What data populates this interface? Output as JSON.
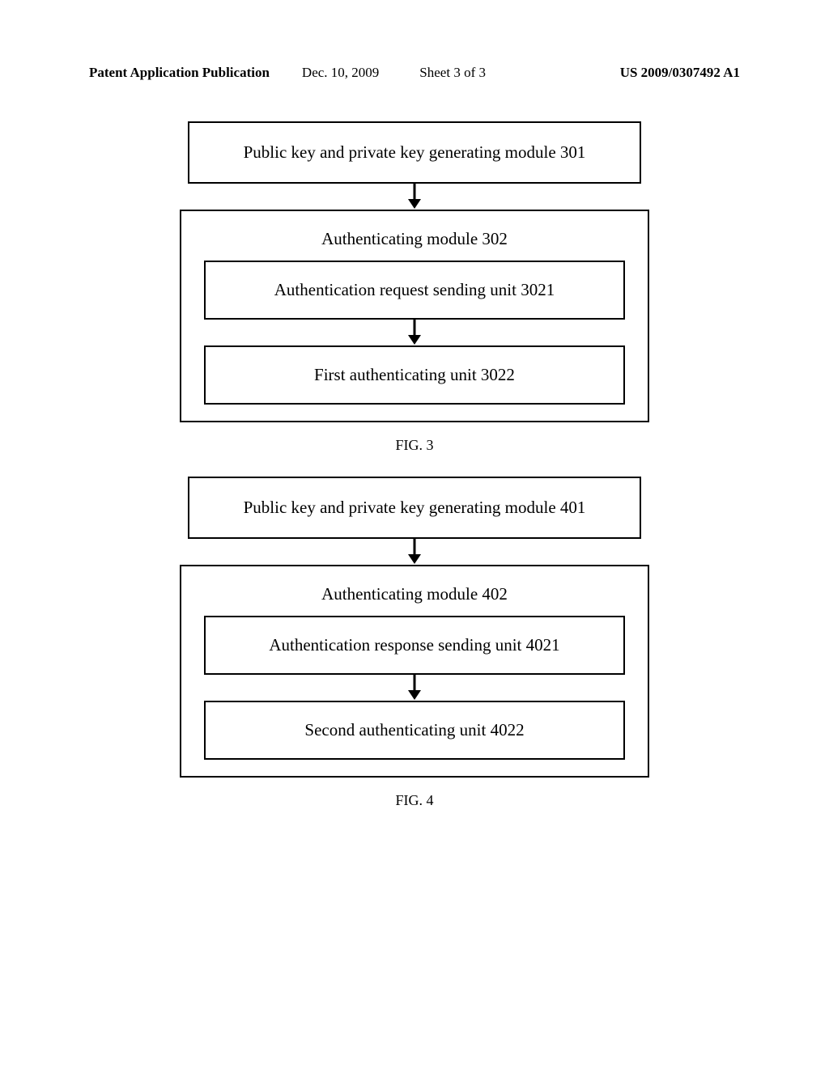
{
  "header": {
    "pub": "Patent Application Publication",
    "date": "Dec. 10, 2009",
    "sheet": "Sheet 3 of 3",
    "num": "US 2009/0307492 A1"
  },
  "fig3": {
    "box1": "Public key and private key generating module 301",
    "outer_title": "Authenticating module 302",
    "inner1": "Authentication request sending unit 3021",
    "inner2": "First authenticating unit 3022",
    "label": "FIG. 3"
  },
  "fig4": {
    "box1": "Public key and private key generating module 401",
    "outer_title": "Authenticating module 402",
    "inner1": "Authentication response sending unit 4021",
    "inner2": "Second authenticating unit 4022",
    "label": "FIG. 4"
  }
}
